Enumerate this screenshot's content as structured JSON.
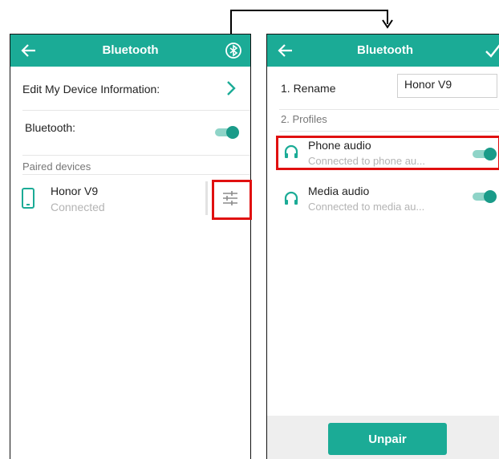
{
  "left_screen": {
    "title": "Bluetooth",
    "edit_info_label": "Edit My Device Information:",
    "bluetooth_label": "Bluetooth:",
    "bluetooth_enabled": true,
    "paired_section_label": "Paired devices",
    "device": {
      "name": "Honor V9",
      "status": "Connected"
    }
  },
  "right_screen": {
    "title": "Bluetooth",
    "rename_label": "1. Rename",
    "rename_value": "Honor V9",
    "profiles_label": "2. Profiles",
    "profiles": [
      {
        "name": "Phone audio",
        "status": "Connected to phone au...",
        "enabled": true
      },
      {
        "name": "Media audio",
        "status": "Connected to media au...",
        "enabled": true
      }
    ],
    "unpair_label": "Unpair"
  },
  "colors": {
    "accent": "#1bab96",
    "toggle_knob": "#1a9b89",
    "highlight": "#e01010"
  }
}
